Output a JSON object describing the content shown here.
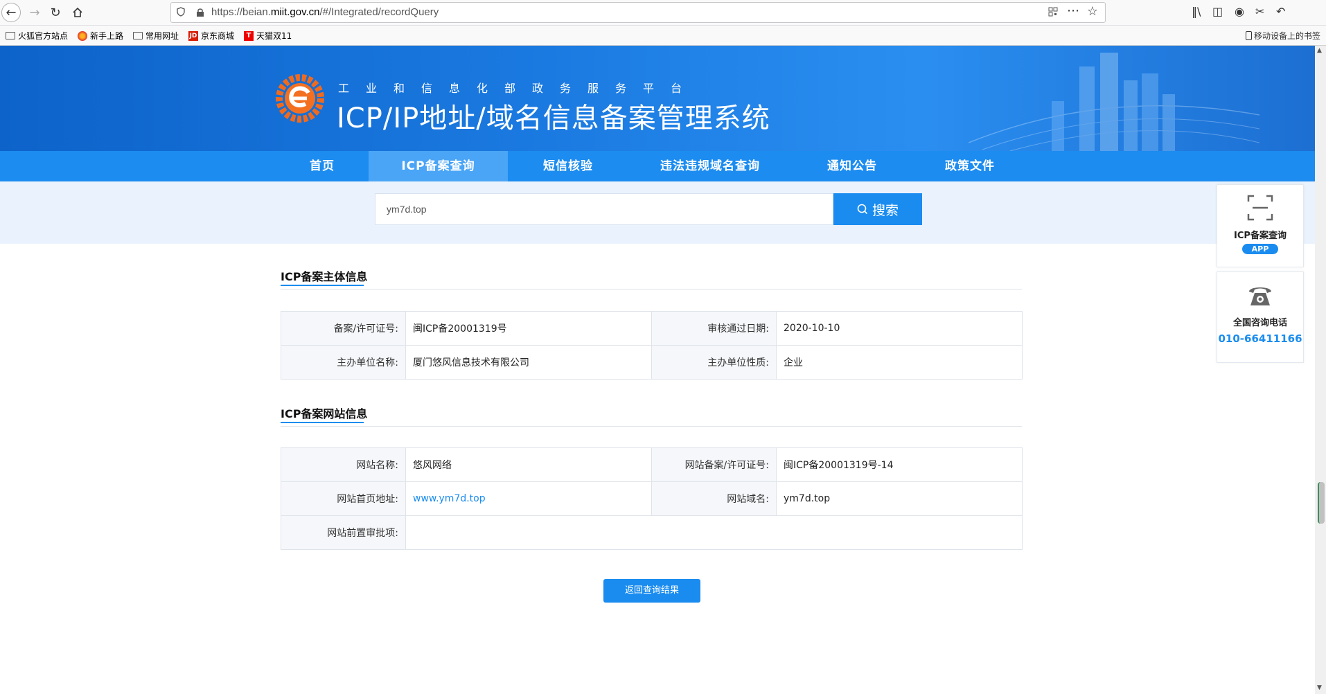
{
  "browser": {
    "url_prefix": "https://beian.",
    "url_domain": "miit.gov.cn",
    "url_suffix": "/#/Integrated/recordQuery",
    "bookmarks": [
      "火狐官方站点",
      "新手上路",
      "常用网址",
      "京东商城",
      "天猫双11"
    ],
    "mobile_bookmarks": "移动设备上的书签"
  },
  "header": {
    "subtitle": "工业和信息化部政务服务平台",
    "title": "ICP/IP地址/域名信息备案管理系统"
  },
  "nav": {
    "items": [
      "首页",
      "ICP备案查询",
      "短信核验",
      "违法违规域名查询",
      "通知公告",
      "政策文件"
    ],
    "active": "ICP备案查询"
  },
  "search": {
    "value": "ym7d.top",
    "button": "搜索"
  },
  "subject_section": {
    "title": "ICP备案主体信息",
    "rows": [
      {
        "l1": "备案/许可证号:",
        "v1": "闽ICP备20001319号",
        "l2": "审核通过日期:",
        "v2": "2020-10-10"
      },
      {
        "l1": "主办单位名称:",
        "v1": "厦门悠风信息技术有限公司",
        "l2": "主办单位性质:",
        "v2": "企业"
      }
    ]
  },
  "site_section": {
    "title": "ICP备案网站信息",
    "rows": [
      {
        "l1": "网站名称:",
        "v1": "悠风网络",
        "l2": "网站备案/许可证号:",
        "v2": "闽ICP备20001319号-14"
      },
      {
        "l1": "网站首页地址:",
        "v1": "www.ym7d.top",
        "l2": "网站域名:",
        "v2": "ym7d.top"
      },
      {
        "l1": "网站前置审批项:",
        "v1": ""
      }
    ]
  },
  "back_button": "返回查询结果",
  "side": {
    "app_label": "ICP备案查询",
    "app_badge": "APP",
    "phone_label": "全国咨询电话",
    "phone_number": "010-66411166"
  },
  "colors": {
    "accent": "#1a8cf0",
    "nav_bg": "#1c8cf0",
    "banner": "#1a79e0"
  }
}
